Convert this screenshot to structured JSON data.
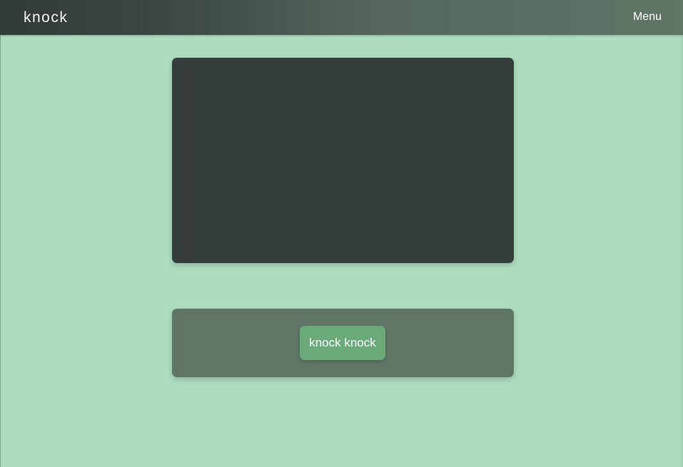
{
  "header": {
    "brand": "knock",
    "menu_label": "Menu"
  },
  "main": {
    "button_label": "knock knock"
  },
  "colors": {
    "background": "#addcbf",
    "navbar_start": "#323a3a",
    "navbar_end": "#5f7666",
    "display_panel": "#353e3d",
    "control_panel": "#5f7666",
    "button": "#6aaa79"
  }
}
